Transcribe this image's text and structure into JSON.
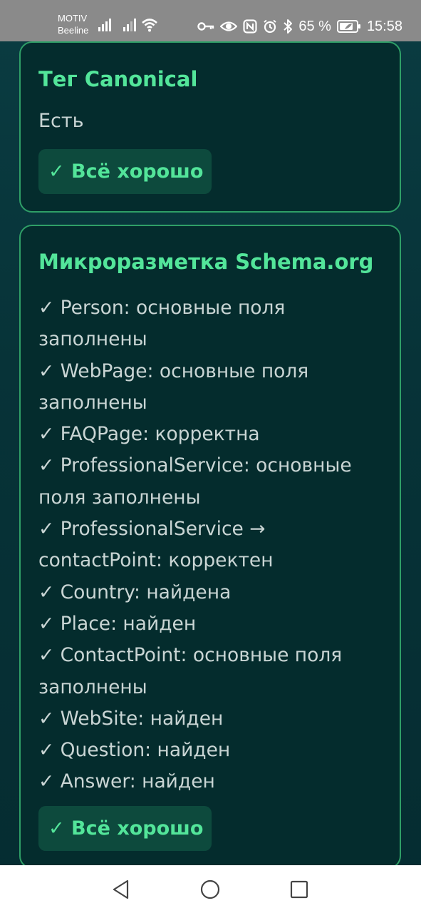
{
  "status_bar": {
    "carrier_line1": "MOTIV",
    "carrier_line2": "Beeline",
    "battery": "65 %",
    "time": "15:58",
    "icons": [
      "signal-icon",
      "signal-icon",
      "wifi-icon",
      "key-icon",
      "eye-icon",
      "nfc-icon",
      "alarm-icon",
      "bluetooth-icon",
      "battery-icon"
    ]
  },
  "cards": [
    {
      "title": "Тег Canonical",
      "text": "Есть",
      "badge": "✓ Всё хорошо"
    },
    {
      "title": "Микроразметка Schema.org",
      "items": [
        "✓ Person: основные поля заполнены",
        "✓ WebPage: основные поля заполнены",
        "✓ FAQPage: корректна",
        "✓ ProfessionalService: основные поля заполнены",
        "✓ ProfessionalService → contactPoint: корректен",
        "✓ Country: найдена",
        "✓ Place: найден",
        "✓ ContactPoint: основные поля заполнены",
        "✓ WebSite: найден",
        "✓ Question: найден",
        "✓ Answer: найден"
      ],
      "badge": "✓ Всё хорошо"
    }
  ],
  "nav_bar": {
    "icons": [
      "back-icon",
      "home-icon",
      "recents-icon"
    ]
  },
  "colors": {
    "accent": "#53e59a",
    "card_border": "#2f9f67",
    "card_bg": "#042c2d",
    "badge_bg": "#0d4a3d",
    "text": "#c9d5d4"
  }
}
